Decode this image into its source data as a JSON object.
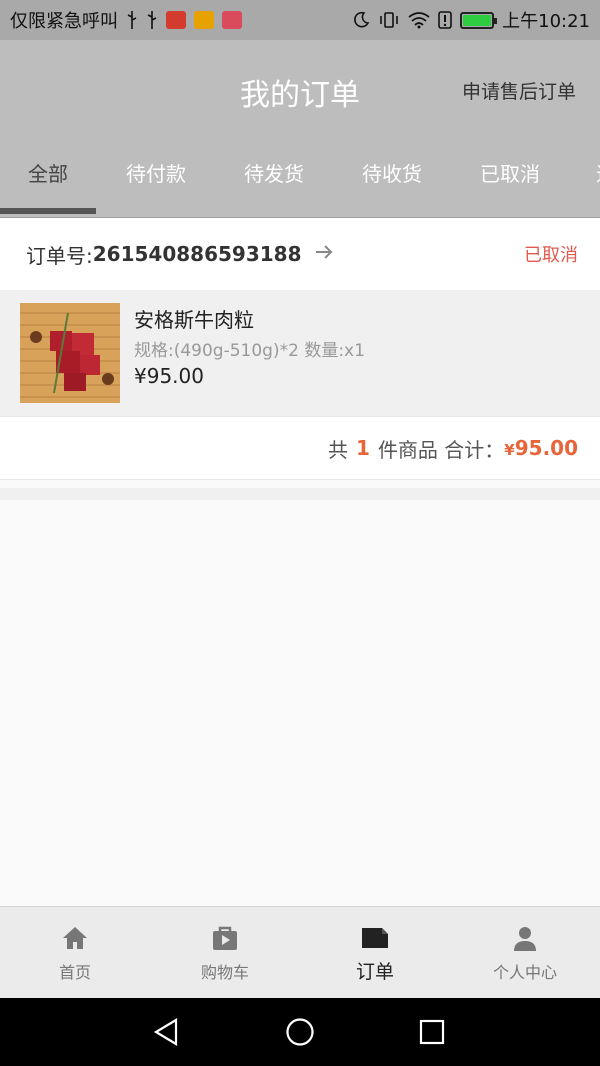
{
  "status_bar": {
    "left_text": "仅限紧急呼叫",
    "time": "上午10:21",
    "icons": [
      "usb-icon",
      "usb-icon",
      "app-icon",
      "app-icon",
      "app-icon",
      "moon-icon",
      "vibrate-icon",
      "wifi-icon",
      "alert-icon",
      "battery-icon"
    ],
    "battery_color": "#2ecc40"
  },
  "header": {
    "title": "我的订单",
    "aftersale_label": "申请售后订单"
  },
  "tabs": [
    {
      "label": "全部"
    },
    {
      "label": "待付款"
    },
    {
      "label": "待发货"
    },
    {
      "label": "待收货"
    },
    {
      "label": "已取消"
    },
    {
      "label": "退"
    }
  ],
  "order": {
    "number_label": "订单号:",
    "number": "261540886593188",
    "status": "已取消",
    "goods": {
      "name": "安格斯牛肉粒",
      "spec": "规格:(490g-510g)*2 数量:x1",
      "price": "¥95.00"
    },
    "summary": {
      "prefix": "共",
      "count": "1",
      "middle": "件商品 合计：",
      "yen": "¥",
      "total": "95.00"
    }
  },
  "bottom_nav": [
    {
      "label": "首页",
      "icon": "home-icon"
    },
    {
      "label": "购物车",
      "icon": "shopping-bag-icon"
    },
    {
      "label": "订单",
      "icon": "order-icon"
    },
    {
      "label": "个人中心",
      "icon": "person-icon"
    }
  ],
  "colors": {
    "accent": "#e8643a",
    "status_cancelled": "#e05a4e",
    "header_bg": "#bdbdbd"
  }
}
